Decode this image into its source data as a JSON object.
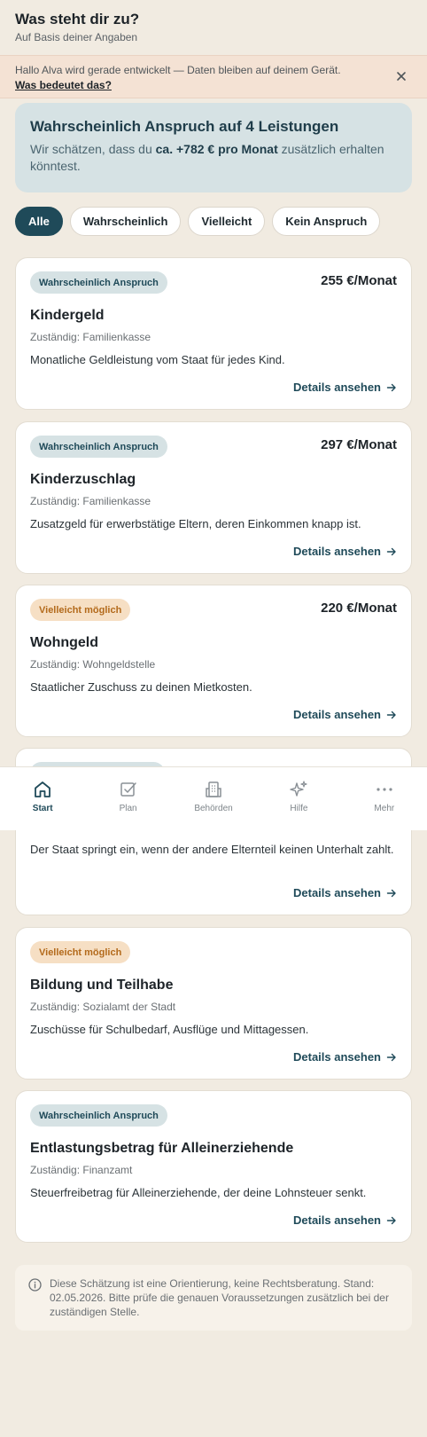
{
  "header": {
    "title": "Was steht dir zu?",
    "subtitle": "Auf Basis deiner Angaben"
  },
  "banner": {
    "text": "Hallo Alva wird gerade entwickelt — Daten bleiben auf deinem Gerät.",
    "link": "Was bedeutet das?"
  },
  "summary": {
    "title": "Wahrscheinlich Anspruch auf 4 Leistungen",
    "text_before": "Wir schätzen, dass du ",
    "amount": "ca. +782 € pro Monat",
    "text_after": " zusätzlich erhalten könntest."
  },
  "filters": [
    "Alle",
    "Wahrscheinlich",
    "Vielleicht",
    "Kein Anspruch"
  ],
  "details_label": "Details ansehen",
  "cards": [
    {
      "badge": "Wahrscheinlich Anspruch",
      "amount": "255 €/Monat",
      "title": "Kindergeld",
      "authority": "Zuständig: Familienkasse",
      "description": "Monatliche Geldleistung vom Staat für jedes Kind."
    },
    {
      "badge": "Wahrscheinlich Anspruch",
      "amount": "297 €/Monat",
      "title": "Kinderzuschlag",
      "authority": "Zuständig: Familienkasse",
      "description": "Zusatzgeld für erwerbstätige Eltern, deren Einkommen knapp ist."
    },
    {
      "badge": "Vielleicht möglich",
      "amount": "220 €/Monat",
      "title": "Wohngeld",
      "authority": "Zuständig: Wohngeldstelle",
      "description": "Staatlicher Zuschuss zu deinen Mietkosten."
    },
    {
      "description": "Der Staat springt ein, wenn der andere Elternteil keinen Unterhalt zahlt."
    },
    {
      "badge": "Vielleicht möglich",
      "title": "Bildung und Teilhabe",
      "authority": "Zuständig: Sozialamt der Stadt",
      "description": "Zuschüsse für Schulbedarf, Ausflüge und Mittagessen."
    },
    {
      "badge": "Wahrscheinlich Anspruch",
      "title": "Entlastungsbetrag für Alleinerziehende",
      "authority": "Zuständig: Finanzamt",
      "description": "Steuerfreibetrag für Alleinerziehende, der deine Lohnsteuer senkt."
    }
  ],
  "nav": {
    "start": "Start",
    "plan": "Plan",
    "behoerden": "Behörden",
    "hilfe": "Hilfe",
    "mehr": "Mehr"
  },
  "disclaimer": "Diese Schätzung ist eine Orientierung, keine Rechtsberatung. Stand: 02.05.2026. Bitte prüfe die genauen Voraussetzungen zusätzlich bei der zuständigen Stelle."
}
